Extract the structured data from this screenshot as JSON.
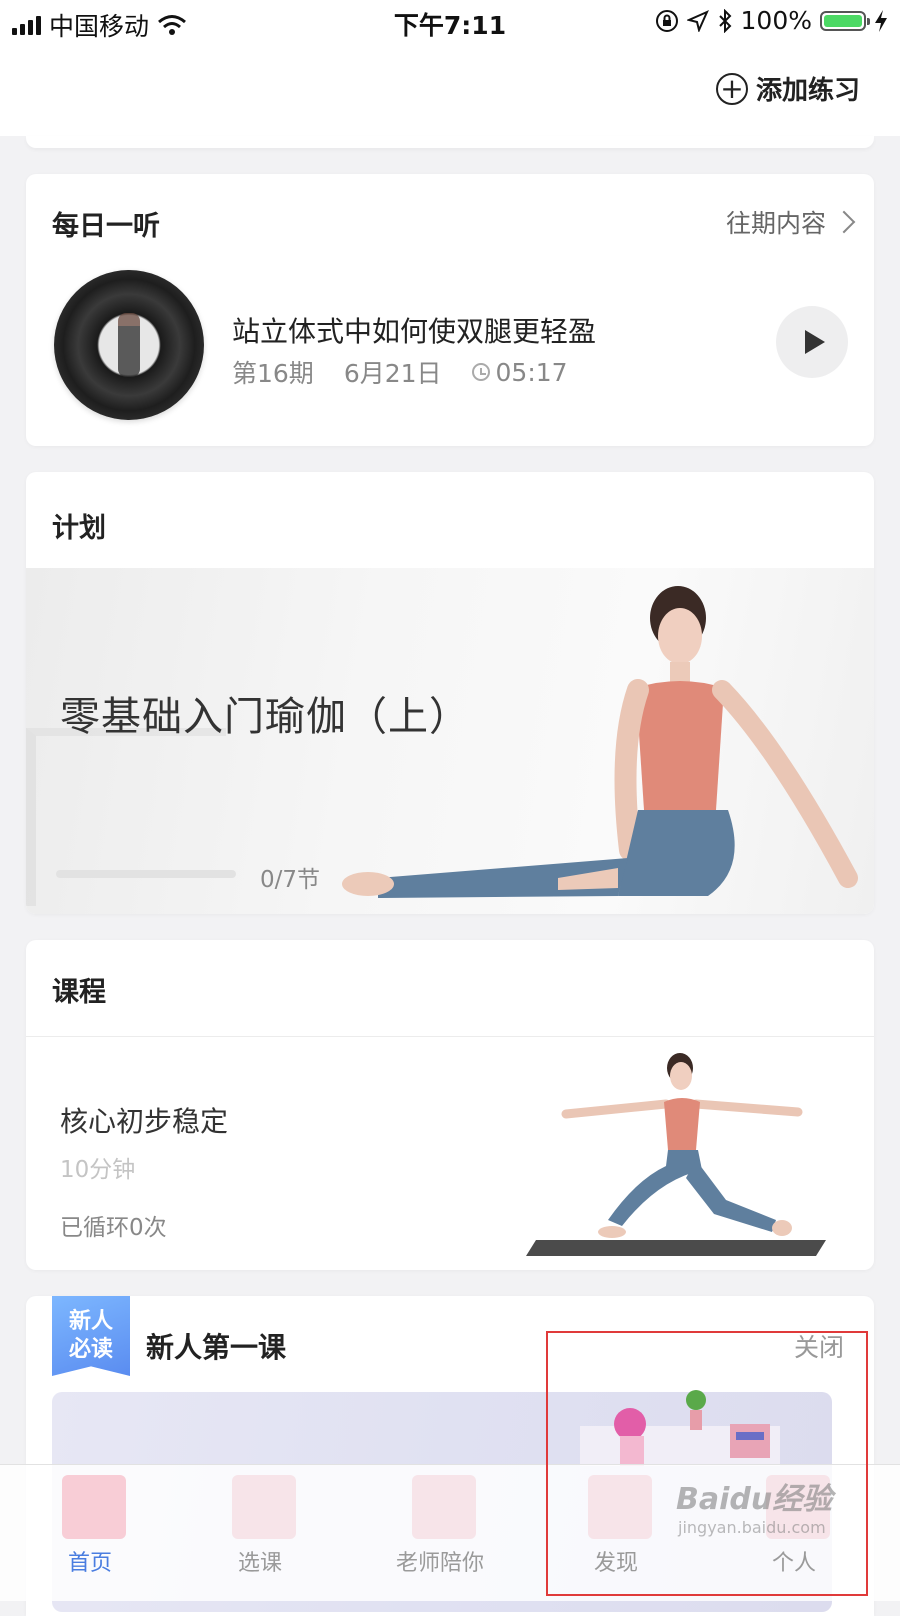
{
  "status_bar": {
    "carrier": "中国移动",
    "time": "下午7:11",
    "battery": "100%"
  },
  "top_nav": {
    "add_label": "添加练习"
  },
  "daily_listen": {
    "title": "每日一听",
    "past_link": "往期内容",
    "episode_title": "站立体式中如何使双腿更轻盈",
    "issue": "第16期",
    "date": "6月21日",
    "duration": "05:17"
  },
  "plan": {
    "title": "计划",
    "name": "零基础入门瑜伽（上）",
    "progress": "0/7节",
    "progress_fraction": 0
  },
  "course": {
    "title": "课程",
    "name": "核心初步稳定",
    "duration": "10分钟",
    "loops": "已循环0次"
  },
  "newbie": {
    "badge": "新人\n必读",
    "title": "新人第一课",
    "close": "关闭"
  },
  "tabs": [
    {
      "label": "首页",
      "active": true
    },
    {
      "label": "选课",
      "active": false
    },
    {
      "label": "老师陪你",
      "active": false
    },
    {
      "label": "发现",
      "active": false
    },
    {
      "label": "个人",
      "active": false
    }
  ],
  "watermark": {
    "text": "Baidu经验",
    "sub": "jingyan.baidu.com"
  },
  "colors": {
    "accent": "#4a7de0",
    "highlight": "#e03a3a",
    "battery": "#4cd964"
  }
}
